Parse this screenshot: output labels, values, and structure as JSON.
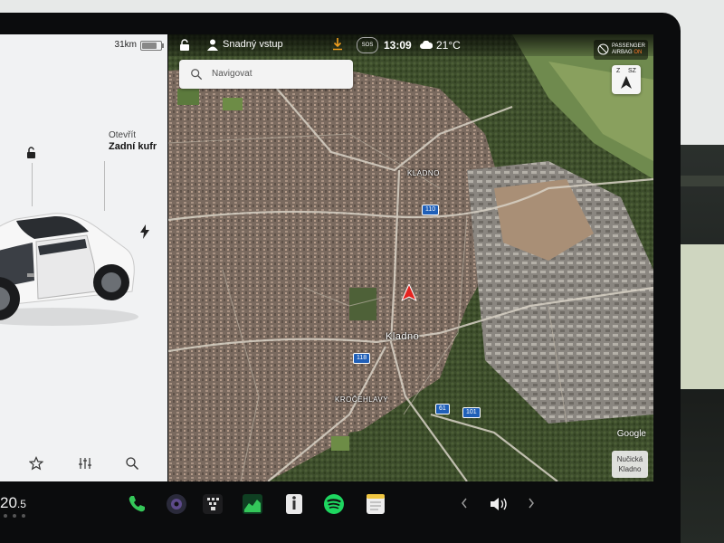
{
  "car_panel": {
    "range": "31km",
    "battery_level": 0.82,
    "trunk_label_line1": "Otevřít",
    "trunk_label_line2": "Zadní kufr"
  },
  "status_bar": {
    "profile_name": "Snadný vstup",
    "sos_label": "SOS",
    "time": "13:09",
    "temperature": "21°C"
  },
  "search": {
    "placeholder": "Navigovat"
  },
  "airbag": {
    "line1": "PASSENGER",
    "line2_prefix": "AIRBAG",
    "line2_state": "ON"
  },
  "compass": {
    "left": "Z",
    "right": "SZ"
  },
  "map_labels": {
    "kladno_north": "KLADNO",
    "kladno_center": "Kladno",
    "krocehlavy": "KROČEHLAVY",
    "attribution": "Google",
    "poi_line1": "Nučická",
    "poi_line2": "Kladno"
  },
  "road_shields": {
    "r110": "110",
    "r118": "118",
    "r61": "61",
    "r101": "101"
  },
  "dock": {
    "cabin_temp_main": "20",
    "cabin_temp_decimal": ".5"
  },
  "colors": {
    "accent_red": "#e52420",
    "phone_green": "#35c759",
    "spotify_green": "#1ed760",
    "airbag_on": "#ff7a2a"
  },
  "icons": {
    "panel": [
      "unlock-icon",
      "lightning-icon",
      "star-icon",
      "sliders-icon",
      "search-icon"
    ],
    "status": [
      "lock-icon",
      "person-icon",
      "download-icon",
      "sos-icon",
      "cloud-icon"
    ],
    "dock": [
      "phone-icon",
      "camera-icon",
      "toybox-icon",
      "energy-icon",
      "manual-icon",
      "spotify-icon",
      "notes-icon",
      "chevron-left-icon",
      "volume-icon",
      "chevron-right-icon"
    ]
  }
}
